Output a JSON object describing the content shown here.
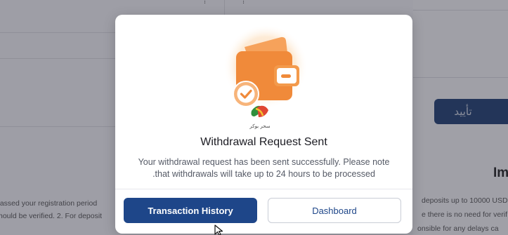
{
  "background": {
    "confirm_button_label": "تأييد",
    "heading_partial": "Im",
    "left_text_line1": "passed your registration period",
    "left_text_line2": "hould be verified. 2. For deposit",
    "right_text_line1": "deposits up to 10000 USD",
    "right_text_line2": "e there is no need for verif",
    "right_text_line3": "onsible for any delays ca",
    "top_left_glyph": "⁞",
    "top_right_glyph": "⁞"
  },
  "modal": {
    "title": "Withdrawal Request Sent",
    "message_line1": "Your withdrawal request has been sent successfully. Please note",
    "message_line2": ".that withdrawals will take up to 24 hours to be processed",
    "primary_button": "Transaction History",
    "secondary_button": "Dashboard"
  },
  "watermark": {
    "text": "سحر بوكر"
  },
  "colors": {
    "brand_blue": "#1e4689",
    "wallet_orange": "#f08a3a"
  }
}
